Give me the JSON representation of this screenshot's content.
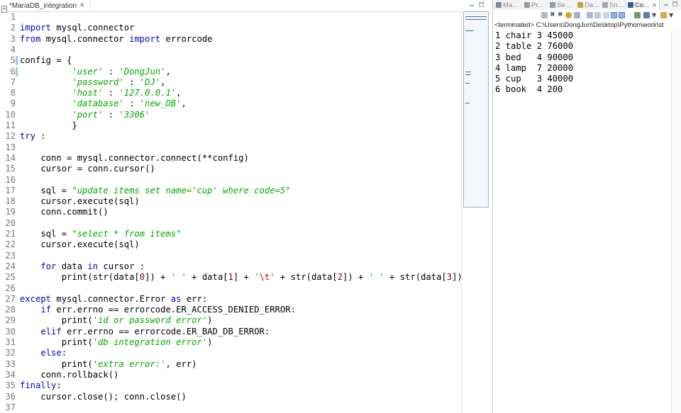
{
  "editor": {
    "tab_title": "*MariaDB_integration",
    "modified_lines": [
      5,
      6
    ],
    "lines": [
      [],
      [
        {
          "t": "import",
          "c": "kw"
        },
        {
          "t": " mysql.connector"
        }
      ],
      [
        {
          "t": "from",
          "c": "kw"
        },
        {
          "t": " mysql.connector "
        },
        {
          "t": "import",
          "c": "kw"
        },
        {
          "t": " errorcode"
        }
      ],
      [],
      [
        {
          "t": "config = {"
        }
      ],
      [
        {
          "t": "          "
        },
        {
          "t": "'user'",
          "c": "dict-key"
        },
        {
          "t": " : "
        },
        {
          "t": "'DongJun'",
          "c": "dict-key"
        },
        {
          "t": ","
        }
      ],
      [
        {
          "t": "          "
        },
        {
          "t": "'password'",
          "c": "dict-key"
        },
        {
          "t": " : "
        },
        {
          "t": "'DJ'",
          "c": "dict-key"
        },
        {
          "t": ","
        }
      ],
      [
        {
          "t": "          "
        },
        {
          "t": "'host'",
          "c": "dict-key"
        },
        {
          "t": " : "
        },
        {
          "t": "'127.0.0.1'",
          "c": "dict-key"
        },
        {
          "t": ","
        }
      ],
      [
        {
          "t": "          "
        },
        {
          "t": "'database'",
          "c": "dict-key"
        },
        {
          "t": " : "
        },
        {
          "t": "'new_DB'",
          "c": "dict-key"
        },
        {
          "t": ","
        }
      ],
      [
        {
          "t": "          "
        },
        {
          "t": "'port'",
          "c": "dict-key"
        },
        {
          "t": " : "
        },
        {
          "t": "'3306'",
          "c": "dict-key"
        }
      ],
      [
        {
          "t": "          }"
        }
      ],
      [
        {
          "t": "try",
          "c": "kw"
        },
        {
          "t": " :"
        }
      ],
      [],
      [
        {
          "t": "    conn = mysql.connector.connect(**config)"
        }
      ],
      [
        {
          "t": "    cursor = conn.cursor()"
        }
      ],
      [],
      [
        {
          "t": "    sql = "
        },
        {
          "t": "\"update items set name='cup' where code=5\"",
          "c": "str"
        }
      ],
      [
        {
          "t": "    cursor.execute(sql)"
        }
      ],
      [
        {
          "t": "    conn.commit()"
        }
      ],
      [],
      [
        {
          "t": "    sql = "
        },
        {
          "t": "\"select * from items\"",
          "c": "str"
        }
      ],
      [
        {
          "t": "    cursor.execute(sql)"
        }
      ],
      [],
      [
        {
          "t": "    "
        },
        {
          "t": "for",
          "c": "kw"
        },
        {
          "t": " data "
        },
        {
          "t": "in",
          "c": "kw"
        },
        {
          "t": " cursor :"
        }
      ],
      [
        {
          "t": "        print(str(data["
        },
        {
          "t": "0",
          "c": "num"
        },
        {
          "t": "]) + "
        },
        {
          "t": "' '",
          "c": "str"
        },
        {
          "t": " + data["
        },
        {
          "t": "1",
          "c": "num"
        },
        {
          "t": "] + "
        },
        {
          "t": "'",
          "c": "str"
        },
        {
          "t": "\\t",
          "c": "esc"
        },
        {
          "t": "'",
          "c": "str"
        },
        {
          "t": " + str(data["
        },
        {
          "t": "2",
          "c": "num"
        },
        {
          "t": "]) + "
        },
        {
          "t": "' '",
          "c": "str"
        },
        {
          "t": " + str(data["
        },
        {
          "t": "3",
          "c": "num"
        },
        {
          "t": "]))"
        }
      ],
      [],
      [
        {
          "t": "except",
          "c": "kw"
        },
        {
          "t": " mysql.connector.Error "
        },
        {
          "t": "as",
          "c": "kw"
        },
        {
          "t": " err:"
        }
      ],
      [
        {
          "t": "    "
        },
        {
          "t": "if",
          "c": "kw"
        },
        {
          "t": " err.errno == errorcode.ER_ACCESS_DENIED_ERROR:"
        }
      ],
      [
        {
          "t": "        print("
        },
        {
          "t": "'id or password error'",
          "c": "str"
        },
        {
          "t": ")"
        }
      ],
      [
        {
          "t": "    "
        },
        {
          "t": "elif",
          "c": "kw"
        },
        {
          "t": " err.errno == errorcode.ER_BAD_DB_ERROR:"
        }
      ],
      [
        {
          "t": "        print("
        },
        {
          "t": "'db integration error'",
          "c": "str"
        },
        {
          "t": ")"
        }
      ],
      [
        {
          "t": "    "
        },
        {
          "t": "else",
          "c": "kw"
        },
        {
          "t": ":"
        }
      ],
      [
        {
          "t": "        print("
        },
        {
          "t": "'extra error:'",
          "c": "str"
        },
        {
          "t": ", err)"
        }
      ],
      [
        {
          "t": "    conn.rollback()"
        }
      ],
      [
        {
          "t": "finally",
          "c": "kw"
        },
        {
          "t": ":"
        }
      ],
      [
        {
          "t": "    cursor.close(); conn.close()"
        }
      ],
      []
    ]
  },
  "console": {
    "tabs": [
      {
        "label": "Ma...",
        "icon": "markers-icon",
        "color": "#7a8aa0",
        "active": false
      },
      {
        "label": "Pr...",
        "icon": "properties-icon",
        "color": "#9a9a9a",
        "active": false
      },
      {
        "label": "Se...",
        "icon": "servers-icon",
        "color": "#8e9bb0",
        "active": false
      },
      {
        "label": "Da...",
        "icon": "data-source-icon",
        "color": "#c8a050",
        "active": false
      },
      {
        "label": "Sn...",
        "icon": "snippets-icon",
        "color": "#9aa8b8",
        "active": false
      },
      {
        "label": "Co...",
        "icon": "console-icon",
        "color": "#2f5f9e",
        "active": true
      }
    ],
    "status": "<terminated> C:\\Users\\DongJun\\Desktop\\Python\\work\\st",
    "output": [
      "1 chair 3 45000",
      "2 table 2 76000",
      "3 bed   4 90000",
      "4 lamp  7 20000",
      "5 cup   3 40000",
      "6 book  4 200"
    ]
  }
}
